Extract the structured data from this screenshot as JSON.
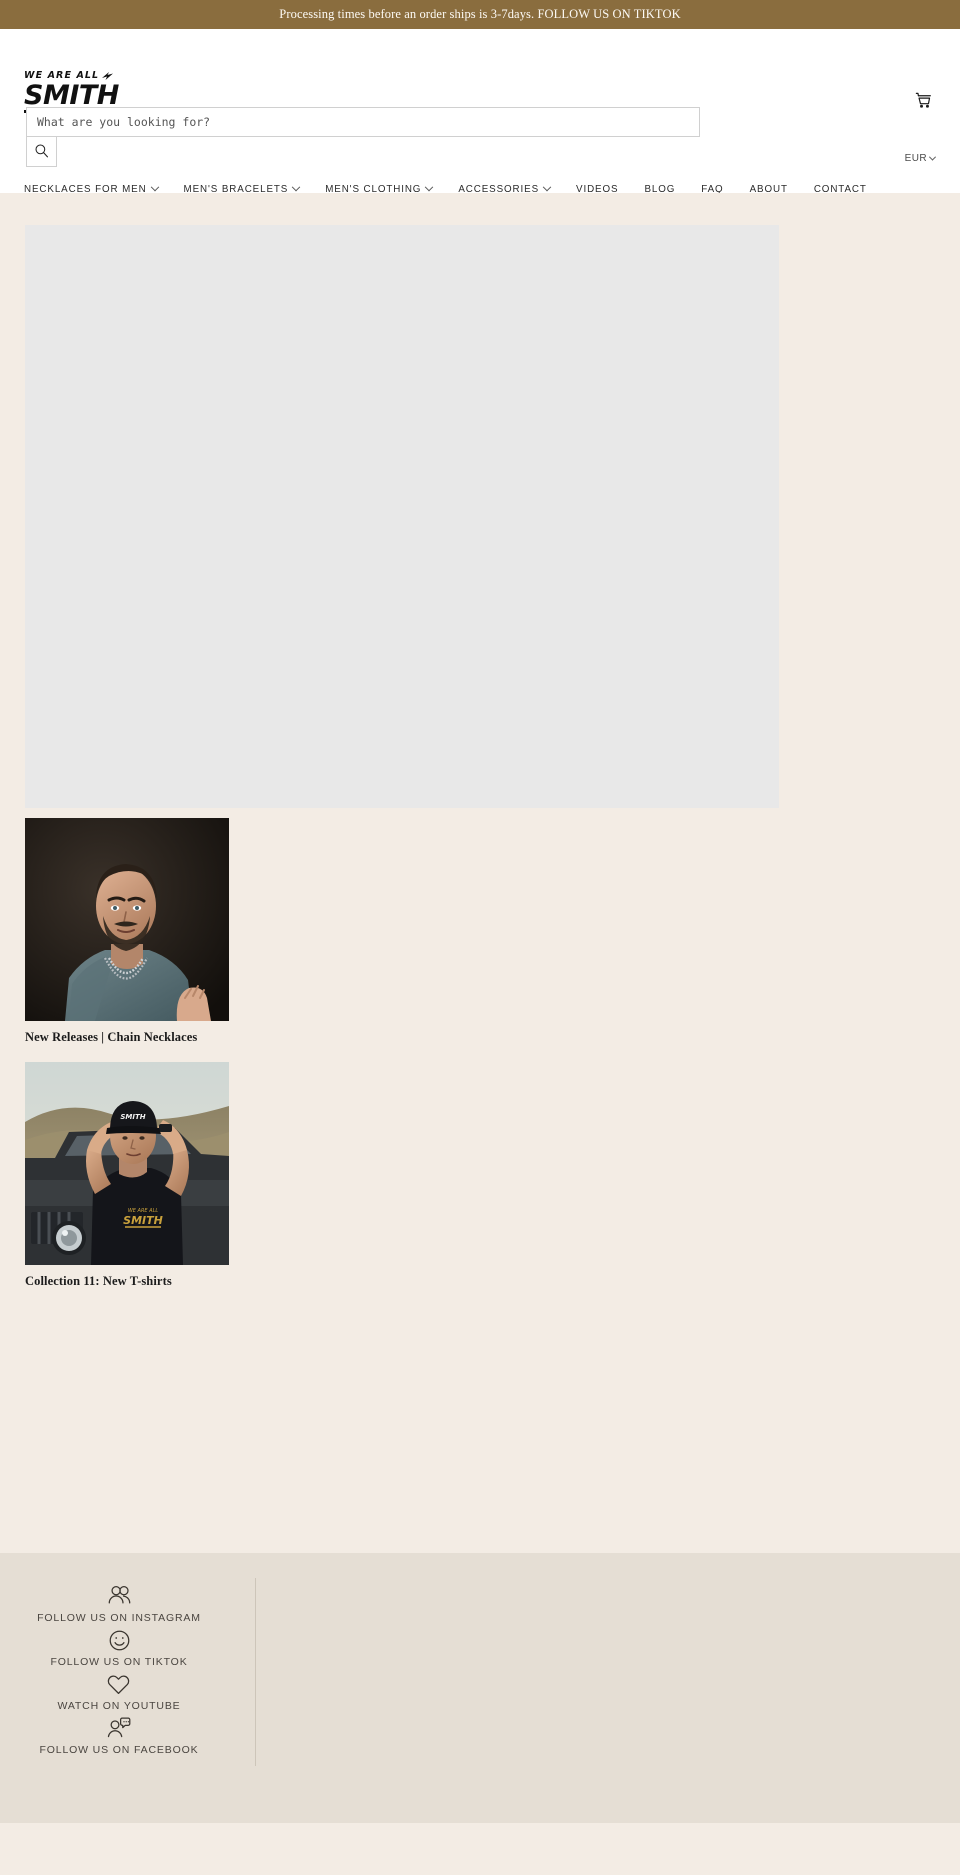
{
  "announcement": {
    "text": "Processing times before an order ships is 3-7days. FOLLOW US ON TIKTOK",
    "background_color": "#8a6d3e",
    "text_color": "#fdfaf5"
  },
  "header": {
    "logo": {
      "top_line": "WE ARE ALL",
      "main_line": "SMITH",
      "bolt_icon": "lightning-bolt-icon"
    },
    "search": {
      "placeholder": "What are you looking for?",
      "value": "",
      "button_icon": "search-icon"
    },
    "cart": {
      "icon": "shopping-cart-icon",
      "label": "Cart"
    },
    "currency": {
      "selected": "EUR",
      "icon": "chevron-down-icon"
    }
  },
  "nav": {
    "items": [
      {
        "label": "NECKLACES FOR MEN",
        "has_dropdown": true
      },
      {
        "label": "MEN'S BRACELETS",
        "has_dropdown": true
      },
      {
        "label": "MEN'S CLOTHING",
        "has_dropdown": true
      },
      {
        "label": "ACCESSORIES",
        "has_dropdown": true
      },
      {
        "label": "VIDEOS",
        "has_dropdown": false
      },
      {
        "label": "BLOG",
        "has_dropdown": false
      },
      {
        "label": "FAQ",
        "has_dropdown": false
      },
      {
        "label": "ABOUT",
        "has_dropdown": false
      },
      {
        "label": "CONTACT",
        "has_dropdown": false
      }
    ]
  },
  "main": {
    "background_color": "#f3ece4",
    "hero": {
      "placeholder_color": "#e8e8e8"
    },
    "cards": [
      {
        "title": "New Releases | Chain Necklaces",
        "image_alt": "Man in teal sweatshirt wearing silver chain necklaces on dark background"
      },
      {
        "title": "Collection 11: New T-shirts",
        "image_alt": "Man in black SMITH t-shirt and cap leaning against a dark SUV on a hillside"
      }
    ]
  },
  "footer": {
    "background_color": "#e5ded4",
    "social_links": [
      {
        "label": "FOLLOW US ON INSTAGRAM",
        "icon": "two-people-icon"
      },
      {
        "label": "FOLLOW US ON TIKTOK",
        "icon": "smiley-face-icon"
      },
      {
        "label": "WATCH ON YOUTUBE",
        "icon": "heart-icon"
      },
      {
        "label": "FOLLOW US ON FACEBOOK",
        "icon": "person-speech-bubble-icon"
      }
    ]
  }
}
